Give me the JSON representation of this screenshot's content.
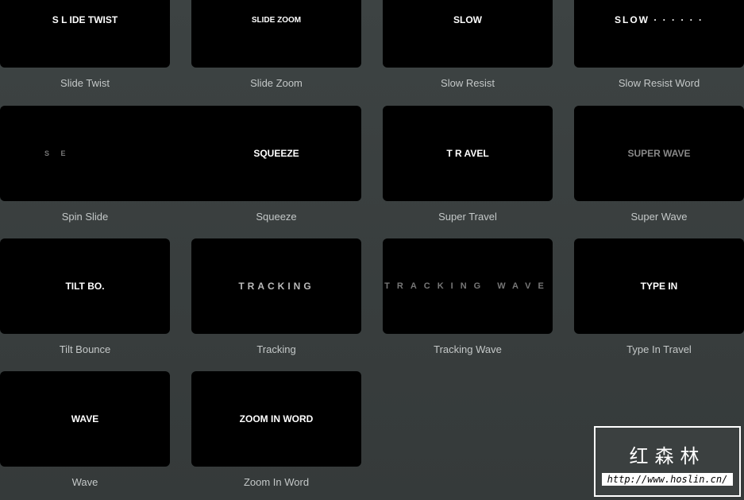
{
  "tiles": [
    {
      "preview": "S L IDE TWIST",
      "label": "Slide Twist"
    },
    {
      "preview": "SLIDE ZOOM",
      "label": "Slide Zoom"
    },
    {
      "preview": "SLOW",
      "label": "Slow Resist"
    },
    {
      "preview": "SLOW · · · · · ·",
      "label": "Slow Resist Word"
    },
    {
      "preview": "S E",
      "label": "Spin Slide"
    },
    {
      "preview": "SQUEEZE",
      "label": "Squeeze"
    },
    {
      "preview": "T    R AVEL",
      "label": "Super Travel"
    },
    {
      "preview": "SUPER WAVE",
      "label": "Super Wave"
    },
    {
      "preview": "TILT BO.",
      "label": "Tilt Bounce"
    },
    {
      "preview": "TRACKING",
      "label": "Tracking"
    },
    {
      "preview": "TRACKING WAVE",
      "label": "Tracking Wave"
    },
    {
      "preview": "TYPE IN",
      "label": "Type In Travel"
    },
    {
      "preview": "WAVE",
      "label": "Wave"
    },
    {
      "preview": "ZOOM IN WORD",
      "label": "Zoom In Word"
    }
  ],
  "watermark": {
    "title": "红森林",
    "url": "http://www.hoslin.cn/"
  }
}
